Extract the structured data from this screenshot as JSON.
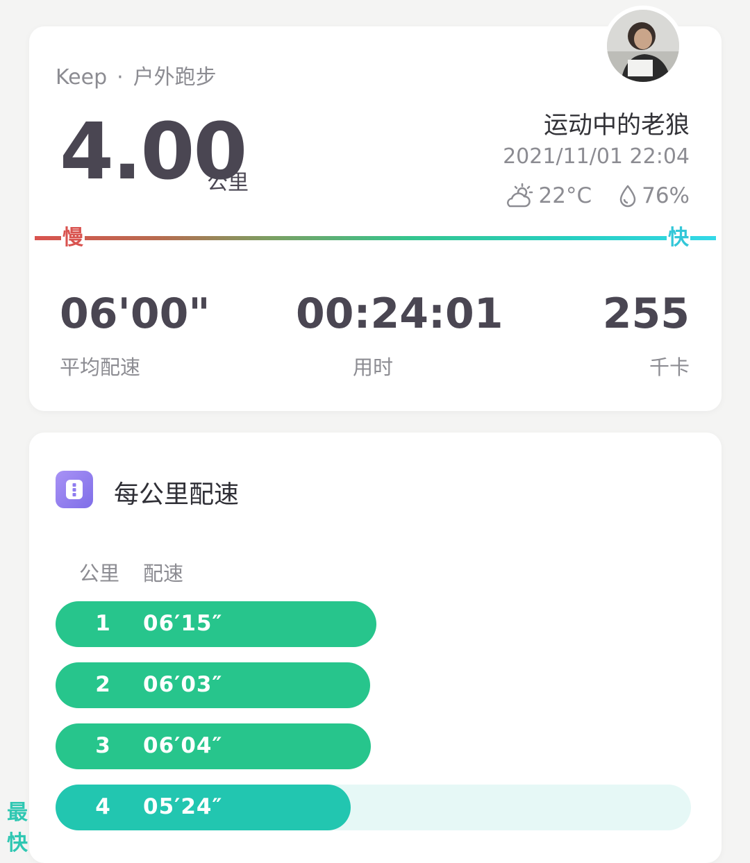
{
  "summary": {
    "app": "Keep",
    "separator": "·",
    "sport": "户外跑步",
    "distance": "4.00",
    "distance_unit": "公里",
    "username": "运动中的老狼",
    "datetime": "2021/11/01 22:04",
    "temperature": "22°C",
    "humidity": "76%",
    "weather_icon": "partly-cloudy-icon",
    "humidity_icon": "water-drop-icon",
    "slow_label": "慢",
    "fast_label": "快",
    "stats": [
      {
        "value": "06'00\"",
        "label": "平均配速"
      },
      {
        "value": "00:24:01",
        "label": "用时"
      },
      {
        "value": "255",
        "label": "千卡"
      }
    ]
  },
  "pace_section": {
    "title": "每公里配速",
    "col_km": "公里",
    "col_pace": "配速",
    "best_tag": "最快",
    "rows": [
      {
        "km": "1",
        "pace": "06′15″",
        "fill": 0.505
      },
      {
        "km": "2",
        "pace": "06′03″",
        "fill": 0.495
      },
      {
        "km": "3",
        "pace": "06′04″",
        "fill": 0.496
      },
      {
        "km": "4",
        "pace": "05′24″",
        "fill": 0.465,
        "best": true
      }
    ]
  },
  "colors": {
    "pace_green": "#27c58c",
    "pace_best": "#22c6b0",
    "slow": "#d9534f",
    "fast": "#33c7d8"
  }
}
